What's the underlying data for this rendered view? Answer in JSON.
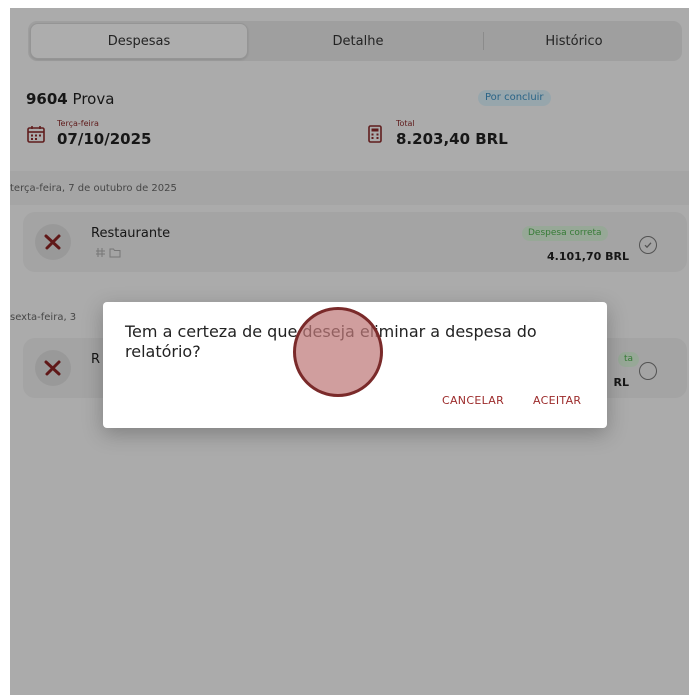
{
  "tabs": [
    {
      "label": "Despesas"
    },
    {
      "label": "Detalhe"
    },
    {
      "label": "Histórico"
    }
  ],
  "report": {
    "number": "9604",
    "name": "Prova",
    "status": "Por concluir",
    "date_label": "Terça-feira",
    "date_value": "07/10/2025",
    "total_label": "Total",
    "total_value": "8.203,40 BRL"
  },
  "groups": [
    {
      "label": "terça-feira, 7 de outubro de 2025"
    },
    {
      "label": "sexta-feira, 3"
    }
  ],
  "expenses": [
    {
      "title": "Restaurante",
      "badge": "Despesa correta",
      "amount": "4.101,70 BRL"
    },
    {
      "title": "R",
      "badge": "ta",
      "amount": "RL"
    }
  ],
  "dialog": {
    "message": "Tem a certeza de que deseja eliminar a despesa do relatório?",
    "cancel_label": "CANCELAR",
    "accept_label": "ACEITAR"
  },
  "colors": {
    "accent": "#9c2b2b",
    "status_blue": "#3b8fc1",
    "ok_green": "#4fb14f"
  }
}
